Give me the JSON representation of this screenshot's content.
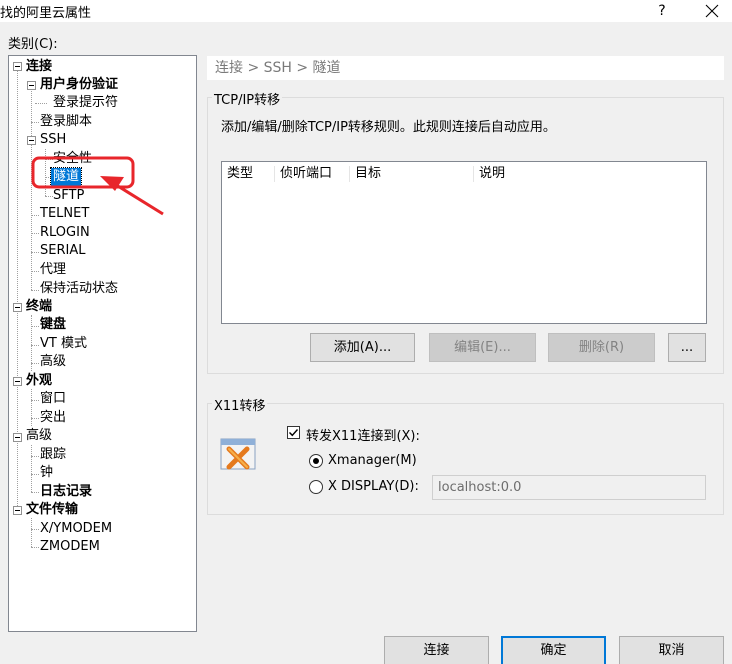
{
  "window": {
    "title": "找的阿里云属性",
    "help_glyph": "?"
  },
  "category_label": "类别(C):",
  "tree": [
    {
      "label": "连接",
      "bold": true
    },
    {
      "label": "用户身份验证",
      "bold": true
    },
    {
      "label": "登录提示符",
      "bold": false
    },
    {
      "label": "登录脚本",
      "bold": false
    },
    {
      "label": "SSH",
      "bold": false
    },
    {
      "label": "安全性",
      "bold": false
    },
    {
      "label": "隧道",
      "bold": false,
      "selected": true
    },
    {
      "label": "SFTP",
      "bold": false
    },
    {
      "label": "TELNET",
      "bold": false
    },
    {
      "label": "RLOGIN",
      "bold": false
    },
    {
      "label": "SERIAL",
      "bold": false
    },
    {
      "label": "代理",
      "bold": false
    },
    {
      "label": "保持活动状态",
      "bold": false
    },
    {
      "label": "终端",
      "bold": true
    },
    {
      "label": "键盘",
      "bold": true
    },
    {
      "label": "VT 模式",
      "bold": false
    },
    {
      "label": "高级",
      "bold": false
    },
    {
      "label": "外观",
      "bold": true
    },
    {
      "label": "窗口",
      "bold": false
    },
    {
      "label": "突出",
      "bold": false
    },
    {
      "label": "高级",
      "bold": false
    },
    {
      "label": "跟踪",
      "bold": false
    },
    {
      "label": "钟",
      "bold": false
    },
    {
      "label": "日志记录",
      "bold": true
    },
    {
      "label": "文件传输",
      "bold": true
    },
    {
      "label": "X/YMODEM",
      "bold": false
    },
    {
      "label": "ZMODEM",
      "bold": false
    }
  ],
  "breadcrumb": "连接 > SSH > 隧道",
  "tcp": {
    "title": "TCP/IP转移",
    "description": "添加/编辑/删除TCP/IP转移规则。此规则连接后自动应用。",
    "columns": [
      "类型",
      "侦听端口",
      "目标",
      "说明"
    ],
    "buttons": {
      "add": "添加(A)...",
      "edit": "编辑(E)...",
      "delete": "删除(R)",
      "more": "..."
    }
  },
  "x11": {
    "title": "X11转移",
    "checkbox_label": "转发X11连接到(X):",
    "checked": true,
    "radio_xmanager": "Xmanager(M)",
    "radio_xdisplay": "X DISPLAY(D):",
    "selected": "xmanager",
    "display_value": "localhost:0.0"
  },
  "footer": {
    "connect": "连接",
    "ok": "确定",
    "cancel": "取消"
  },
  "colors": {
    "selection": "#0078d7",
    "annotation": "#e8262b",
    "dialog_bg": "#f0f0f0"
  }
}
